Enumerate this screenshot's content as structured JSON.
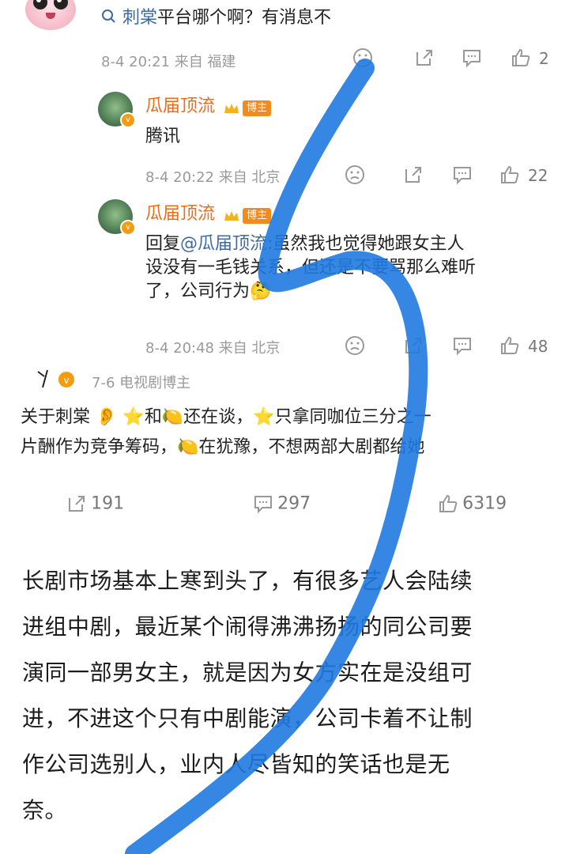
{
  "thread": {
    "top_reply": {
      "search_term": "刺棠",
      "rest": "平台哪个啊？有消息不",
      "meta": "8-4 20:21 来自 福建",
      "like_count": "2"
    },
    "replies": [
      {
        "name": "瓜届顶流",
        "badge": "博主",
        "text": "腾讯",
        "meta": "8-4 20:22 来自 北京",
        "like_count": "22"
      },
      {
        "name": "瓜届顶流",
        "badge": "博主",
        "reply_prefix": "回复",
        "mention": "@瓜届顶流",
        "text_line1": ":虽然我也觉得她跟女主人",
        "text_line2": "设没有一毛钱关系，但还是不要骂那么难听",
        "text_line3": "了，公司行为",
        "meta": "8-4 20:48 来自 北京",
        "like_count": "48"
      }
    ]
  },
  "post": {
    "author_meta": "7-6  电视剧博主",
    "line1_a": "关于刺棠",
    "line1_b": "和",
    "line1_c": "还在谈，",
    "line1_d": "只拿同咖位三分之一",
    "line2_a": "片酬作为竞争筹码，",
    "line2_b": "在犹豫，不想两部大剧都给她",
    "repost_count": "191",
    "comment_count": "297",
    "like_count": "6319"
  },
  "article": {
    "lines": [
      "长剧市场基本上寒到头了，有很多艺人会陆续",
      "进组中剧，最近某个闹得沸沸扬扬的同公司要",
      "演同一部男女主，就是因为女方实在是没组可",
      "进，不进这个只有中剧能演，公司卡着不让制",
      "作公司选别人，业内人尽皆知的笑话也是无",
      "奈。"
    ]
  },
  "colors": {
    "name_orange": "#e86d1d",
    "badge_orange": "#f28a1c",
    "link_blue": "#3e6a9f",
    "scribble_blue": "#1f7ae0"
  }
}
